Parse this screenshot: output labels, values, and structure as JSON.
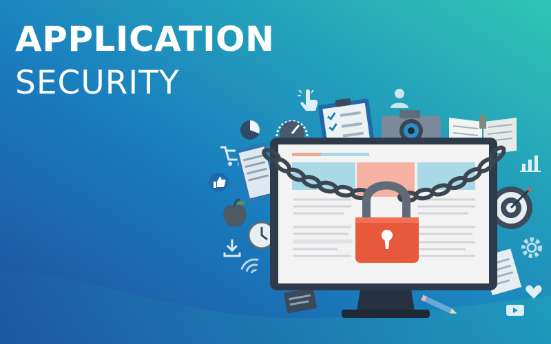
{
  "banner": {
    "title_line_1": "APPLICATION",
    "title_line_2": "SECURITY"
  },
  "illustration": {
    "subject": "computer monitor locked with chain and padlock",
    "icons": [
      "cursor-hand-icon",
      "clipboard-checklist-icon",
      "user-icon",
      "camera-icon",
      "book-icon",
      "pie-chart-icon",
      "gauge-icon",
      "shopping-cart-icon",
      "thumbs-up-icon",
      "apple-icon",
      "clock-icon",
      "download-icon",
      "target-icon",
      "bar-chart-icon",
      "gear-icon",
      "heart-icon",
      "video-icon",
      "pencil-icon",
      "tools-icon",
      "wifi-icon"
    ]
  },
  "colors": {
    "gradient_start": "#1f62b0",
    "gradient_end": "#2ec3b8",
    "padlock": "#e8593b",
    "chain": "#3c4650",
    "monitor_frame": "#2f3a4a",
    "screen": "#f3f3f3"
  }
}
